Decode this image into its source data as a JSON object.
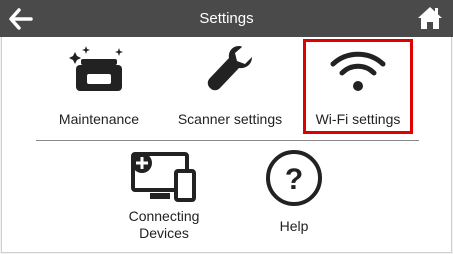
{
  "header": {
    "title": "Settings",
    "back_icon": "arrow-left-icon",
    "home_icon": "home-icon"
  },
  "menu": {
    "items": [
      {
        "label": "Maintenance",
        "icon": "scanner-sparkle-icon"
      },
      {
        "label": "Scanner settings",
        "icon": "wrench-icon"
      },
      {
        "label": "Wi-Fi settings",
        "icon": "wifi-icon",
        "selected": true
      },
      {
        "label": "Connecting\nDevices",
        "icon": "devices-add-icon"
      },
      {
        "label": "Help",
        "icon": "help-circle-icon"
      }
    ]
  },
  "colors": {
    "header_bg": "#4a4a4a",
    "selection": "#e10000",
    "icon": "#222222"
  }
}
